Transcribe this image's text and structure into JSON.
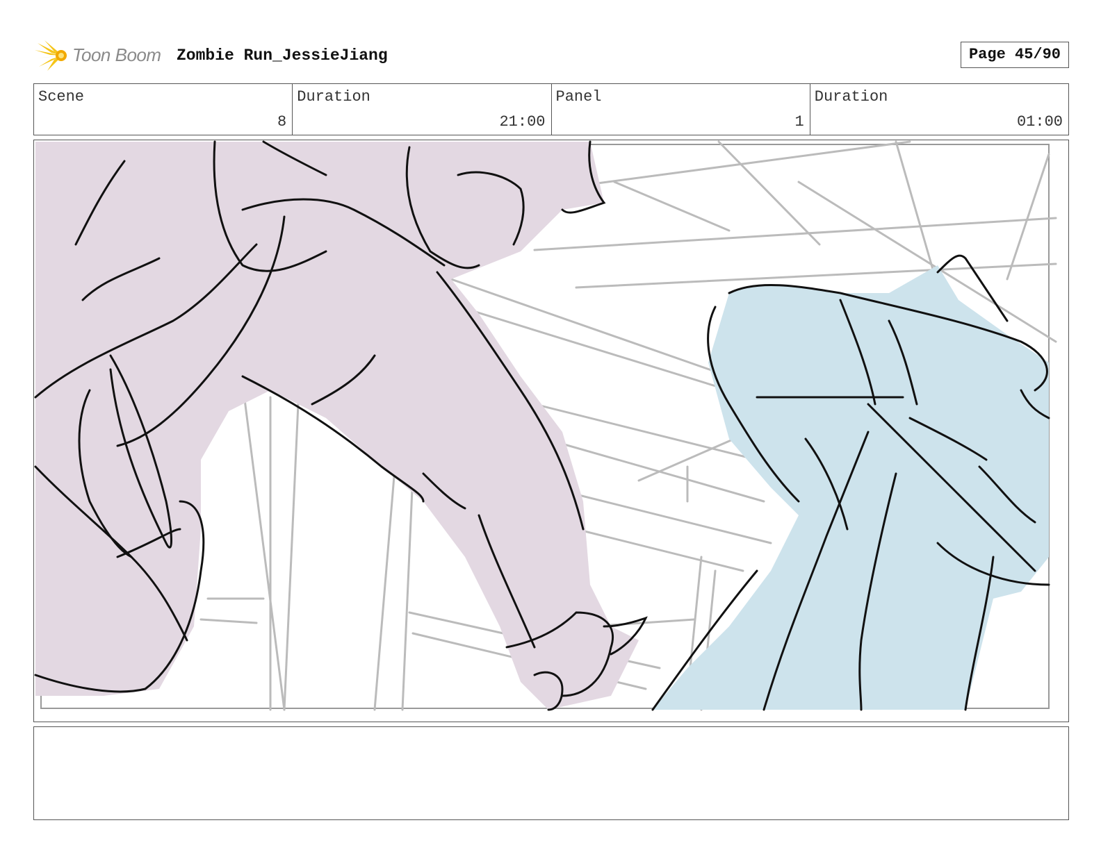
{
  "header": {
    "logo_text": "Toon Boom",
    "project_title": "Zombie Run_JessieJiang",
    "page_label": "Page 45/90"
  },
  "info": {
    "scene_label": "Scene",
    "scene_value": "8",
    "scene_duration_label": "Duration",
    "scene_duration_value": "21:00",
    "panel_label": "Panel",
    "panel_value": "1",
    "panel_duration_label": "Duration",
    "panel_duration_value": "01:00"
  },
  "panel": {
    "colors": {
      "zombie_fill": "#e3d8e2",
      "character_fill": "#cde3ec",
      "ink": "#111111",
      "background_lines": "#bbbbbb"
    }
  },
  "notes": {
    "text": ""
  }
}
